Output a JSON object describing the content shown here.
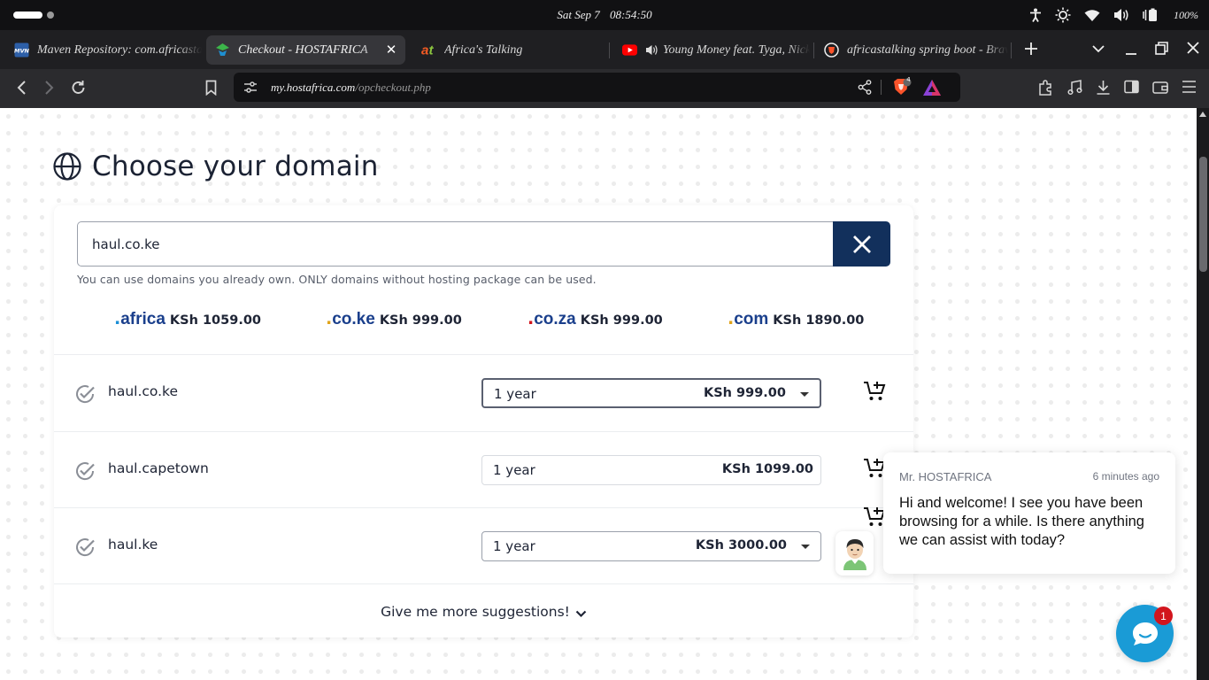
{
  "os": {
    "date": "Sat Sep 7",
    "time": "08:54:50",
    "battery": "100%"
  },
  "tabs": [
    {
      "title": "Maven Repository: com.africastalking",
      "favicon": "maven-favicon",
      "active": false
    },
    {
      "title": "Checkout - HOSTAFRICA",
      "favicon": "hostafrica-favicon",
      "active": true
    },
    {
      "title": "Africa's Talking",
      "favicon": "africastalking-favicon",
      "active": false
    },
    {
      "title": "Young Money feat. Tyga, Nicki",
      "favicon": "youtube-favicon",
      "active": false,
      "playing_audio": true
    },
    {
      "title": "africastalking spring boot - Brave Search",
      "favicon": "brave-favicon",
      "active": false
    }
  ],
  "address_bar": {
    "domain": "my.hostafrica.com",
    "path": "/opcheckout.php",
    "shields_count": "4"
  },
  "page": {
    "heading": "Choose your domain",
    "search": {
      "value": "haul.co.ke",
      "hint": "You can use domains you already own. ONLY domains without hosting package can be used."
    },
    "featured_tlds": [
      {
        "name": "africa",
        "price": "KSh 1059.00",
        "dot_color": "#1b8fd6"
      },
      {
        "name": "co.ke",
        "price": "KSh 999.00",
        "dot_color": "#e0a41b"
      },
      {
        "name": "co.za",
        "price": "KSh 999.00",
        "dot_color": "#d2151d"
      },
      {
        "name": "com",
        "price": "KSh 1890.00",
        "dot_color": "#e0a41b"
      }
    ],
    "results": [
      {
        "domain": "haul.co.ke",
        "period": "1 year",
        "price": "KSh 999.00",
        "has_dropdown": true
      },
      {
        "domain": "haul.capetown",
        "period": "1 year",
        "price": "KSh 1099.00",
        "has_dropdown": false
      },
      {
        "domain": "haul.ke",
        "period": "1 year",
        "price": "KSh 3000.00",
        "has_dropdown": true
      }
    ],
    "more_label": "Give me more suggestions!"
  },
  "chat": {
    "sender": "Mr. HOSTAFRICA",
    "time": "6 minutes ago",
    "message": "Hi and welcome! I see you have been browsing for a while. Is there anything we can assist with today?",
    "unread": "1"
  },
  "colors": {
    "brand_navy": "#12305c",
    "tld_blue": "#1a3f8c",
    "chat_blue": "#1a9bd6",
    "badge_red": "#d2151d"
  }
}
